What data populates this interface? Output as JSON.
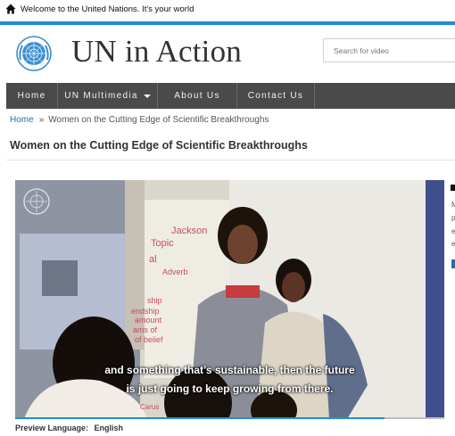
{
  "topbar": {
    "welcome_text": "Welcome to the United Nations. It's your world"
  },
  "header": {
    "site_title": "UN in Action",
    "search_placeholder": "Search for video"
  },
  "nav": {
    "items": [
      {
        "label": "Home"
      },
      {
        "label": "UN Multimedia",
        "has_dropdown": true
      },
      {
        "label": "About Us"
      },
      {
        "label": "Contact Us"
      }
    ]
  },
  "breadcrumb": {
    "home": "Home",
    "separator": "»",
    "current": "Women on the Cutting Edge of Scientific Breakthroughs"
  },
  "page": {
    "title": "Women on the Cutting Edge of Scientific Breakthroughs"
  },
  "video": {
    "caption_line1": "and something that’s sustainable, then the future",
    "caption_line2": "is just going to keep growing from there.",
    "progress": 0.86,
    "whiteboard_words": [
      "Jackson",
      "Topic",
      "al",
      "Adverb",
      "ship",
      "endship",
      "amount",
      "ams of",
      "of belief",
      "Carus"
    ]
  },
  "preview": {
    "label": "Preview Language:",
    "value": "English"
  },
  "side_strip": {
    "letters": [
      "M",
      "p",
      "e",
      "e"
    ]
  },
  "colors": {
    "accent_blue": "#1f8fd6",
    "nav_bg": "#4a4a4a",
    "link_blue": "#1f6fb5"
  }
}
